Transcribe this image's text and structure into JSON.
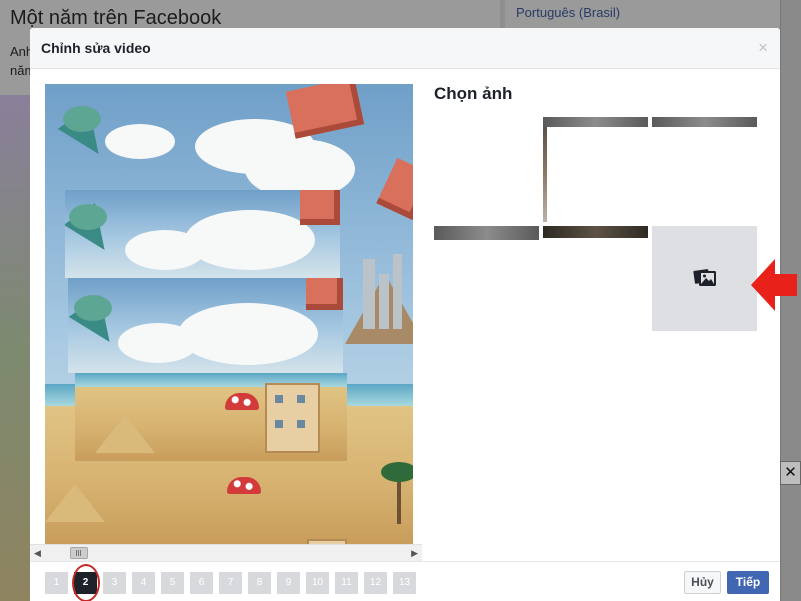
{
  "background_page": {
    "title": "Một năm trên Facebook",
    "snippet": "Anh năm",
    "language_link": "Português (Brasil)",
    "close_glyph": "✕"
  },
  "dialog": {
    "title": "Chỉnh sửa video",
    "close_glyph": "×"
  },
  "thumbnails": {
    "title": "Chọn ảnh",
    "items": [
      {
        "kind": "blank"
      },
      {
        "kind": "photo-bar-edge"
      },
      {
        "kind": "photo-bar"
      },
      {
        "kind": "photo-bar"
      },
      {
        "kind": "photo-bar-dark"
      },
      {
        "kind": "upload",
        "icon": "photo-upload-icon"
      }
    ]
  },
  "scrollbar": {
    "left_arrow": "◀",
    "right_arrow": "▶"
  },
  "pagination": {
    "pages": [
      "1",
      "2",
      "3",
      "4",
      "5",
      "6",
      "7",
      "8",
      "9",
      "10",
      "11",
      "12",
      "13"
    ],
    "active": "2"
  },
  "footer": {
    "cancel_label": "Hủy",
    "next_label": "Tiếp"
  },
  "colors": {
    "primary_button": "#4267b2",
    "annotation": "#e8211b",
    "active_page": "#1d2129"
  }
}
